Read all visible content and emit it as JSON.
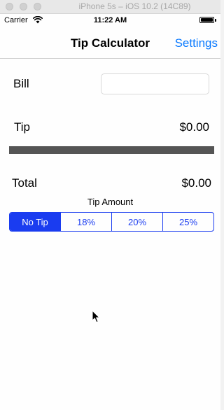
{
  "simulator": {
    "title": "iPhone 5s – iOS 10.2 (14C89)"
  },
  "status_bar": {
    "carrier": "Carrier",
    "time": "11:22 AM",
    "battery_level": 1.0
  },
  "nav": {
    "title": "Tip Calculator",
    "settings_label": "Settings"
  },
  "bill": {
    "label": "Bill",
    "value": "",
    "placeholder": ""
  },
  "tip": {
    "label": "Tip",
    "value": "$0.00"
  },
  "total": {
    "label": "Total",
    "value": "$0.00"
  },
  "tip_amount": {
    "label": "Tip Amount",
    "options": [
      "No Tip",
      "18%",
      "20%",
      "25%"
    ],
    "selected": "No Tip"
  },
  "colors": {
    "accent": "#1a3cf0",
    "nav_link": "#0a7aff",
    "divider_bar": "#555555"
  }
}
